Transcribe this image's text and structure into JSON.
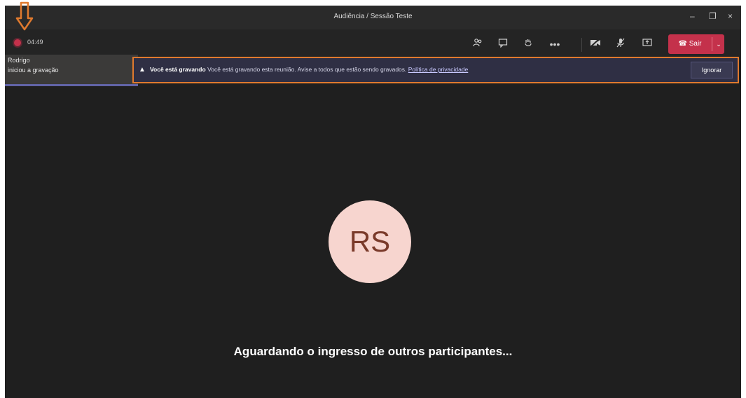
{
  "window": {
    "title": "Audiência / Sessão Teste",
    "minimize": "–",
    "maximize": "❐",
    "close": "×"
  },
  "toolbar": {
    "recording_time": "04:49",
    "icons": [
      "participants-icon",
      "chat-icon",
      "raise-hand-icon",
      "more-options-icon",
      "camera-off-icon",
      "mic-off-icon",
      "share-screen-icon"
    ],
    "leave_label": "Sair",
    "leave_caret": "⌄"
  },
  "toast": {
    "name": "Rodrigo",
    "message": "iniciou a gravação"
  },
  "banner": {
    "title": "Você está gravando",
    "message": "Você está gravando esta reunião. Avise a todos que estão sendo gravados.",
    "privacy_link": "Política de privacidade",
    "ignore_label": "Ignorar"
  },
  "stage": {
    "avatar_initials": "RS",
    "waiting_text": "Aguardando o ingresso de outros participantes..."
  },
  "colors": {
    "leave": "#c4314b",
    "highlight": "#e07a2e",
    "avatar_bg": "#f7d5cf"
  }
}
